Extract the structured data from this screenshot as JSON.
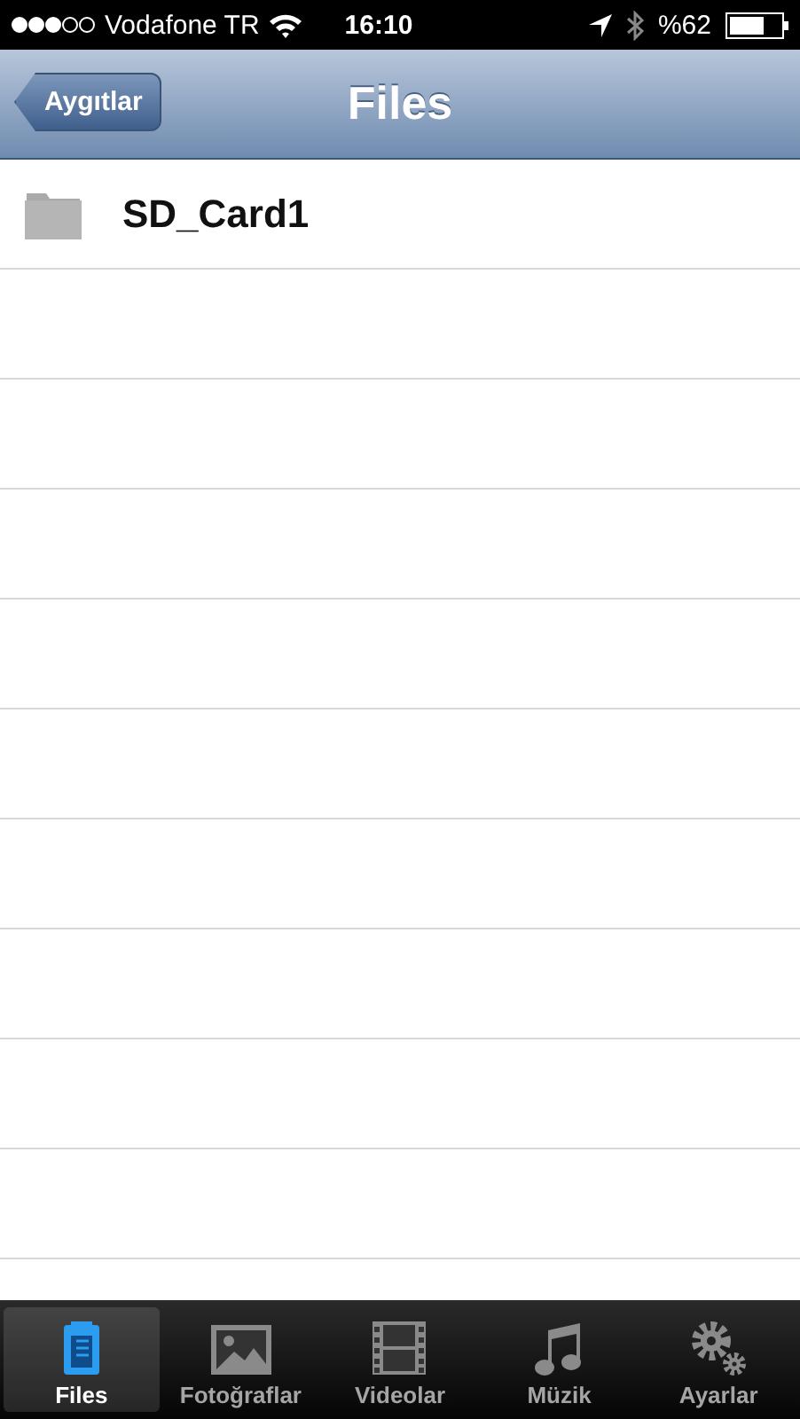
{
  "status_bar": {
    "carrier": "Vodafone TR",
    "time": "16:10",
    "battery": "%62"
  },
  "nav_bar": {
    "back_button": "Aygıtlar",
    "title": "Files"
  },
  "files": [
    {
      "name": "SD_Card1",
      "kind": "folder"
    }
  ],
  "tab_bar": [
    {
      "label": "Files",
      "kind": "files",
      "selected": true
    },
    {
      "label": "Fotoğraflar",
      "kind": "photos",
      "selected": false
    },
    {
      "label": "Videolar",
      "kind": "videos",
      "selected": false
    },
    {
      "label": "Müzik",
      "kind": "music",
      "selected": false
    },
    {
      "label": "Ayarlar",
      "kind": "settings",
      "selected": false
    }
  ]
}
